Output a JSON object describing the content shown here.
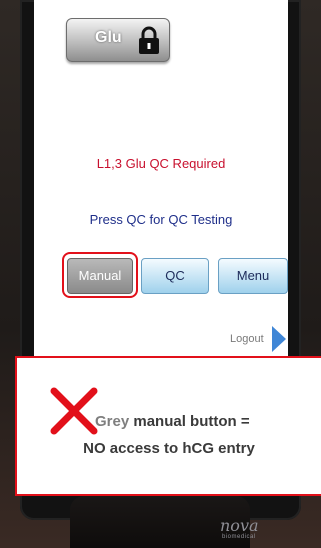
{
  "screen": {
    "glu_button_label": "Glu",
    "qc_required_message": "L1,3 Glu QC Required",
    "press_qc_message": "Press QC for QC Testing",
    "buttons": {
      "manual": "Manual",
      "qc": "QC",
      "menu": "Menu"
    },
    "logout_label": "Logout"
  },
  "callout": {
    "line1_grey": "Grey",
    "line1_rest": " manual button =",
    "line2": "NO access to hCG entry"
  },
  "device": {
    "brand": "nova",
    "brand_sub": "biomedical"
  },
  "icons": {
    "glu": "lock-icon",
    "logout": "arrow-right-icon",
    "callout": "red-x-icon"
  },
  "colors": {
    "alert_red": "#c8102e",
    "info_blue": "#1f2f8a",
    "highlight_red": "#e2101a"
  }
}
